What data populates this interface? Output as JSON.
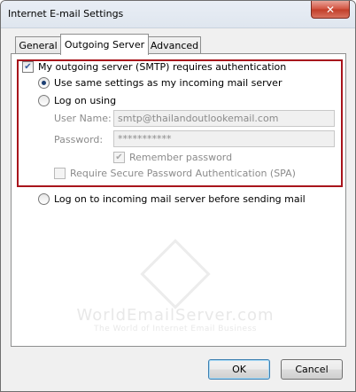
{
  "window": {
    "title": "Internet E-mail Settings",
    "close_glyph": "✕"
  },
  "tabs": [
    {
      "label": "General"
    },
    {
      "label": "Outgoing Server"
    },
    {
      "label": "Advanced"
    }
  ],
  "outgoing": {
    "requires_auth": {
      "label": "My outgoing server (SMTP) requires authentication",
      "checked": true
    },
    "use_same": {
      "label": "Use same settings as my incoming mail server",
      "selected": true
    },
    "log_on_using": {
      "label": "Log on using",
      "selected": false
    },
    "user_name": {
      "label": "User Name:",
      "value": "smtp@thailandoutlookemail.com"
    },
    "password": {
      "label": "Password:",
      "value": "***********"
    },
    "remember_password": {
      "label": "Remember password",
      "checked": true
    },
    "spa": {
      "label": "Require Secure Password Authentication (SPA)",
      "checked": false
    },
    "log_on_incoming": {
      "label": "Log on to incoming mail server before sending mail",
      "selected": false
    }
  },
  "watermark": {
    "title": "WorldEmailServer.com",
    "subtitle": "The World of Internet Email Business"
  },
  "buttons": {
    "ok": "OK",
    "cancel": "Cancel"
  },
  "colors": {
    "highlight": "#a8141c",
    "close": "#c13d28"
  }
}
